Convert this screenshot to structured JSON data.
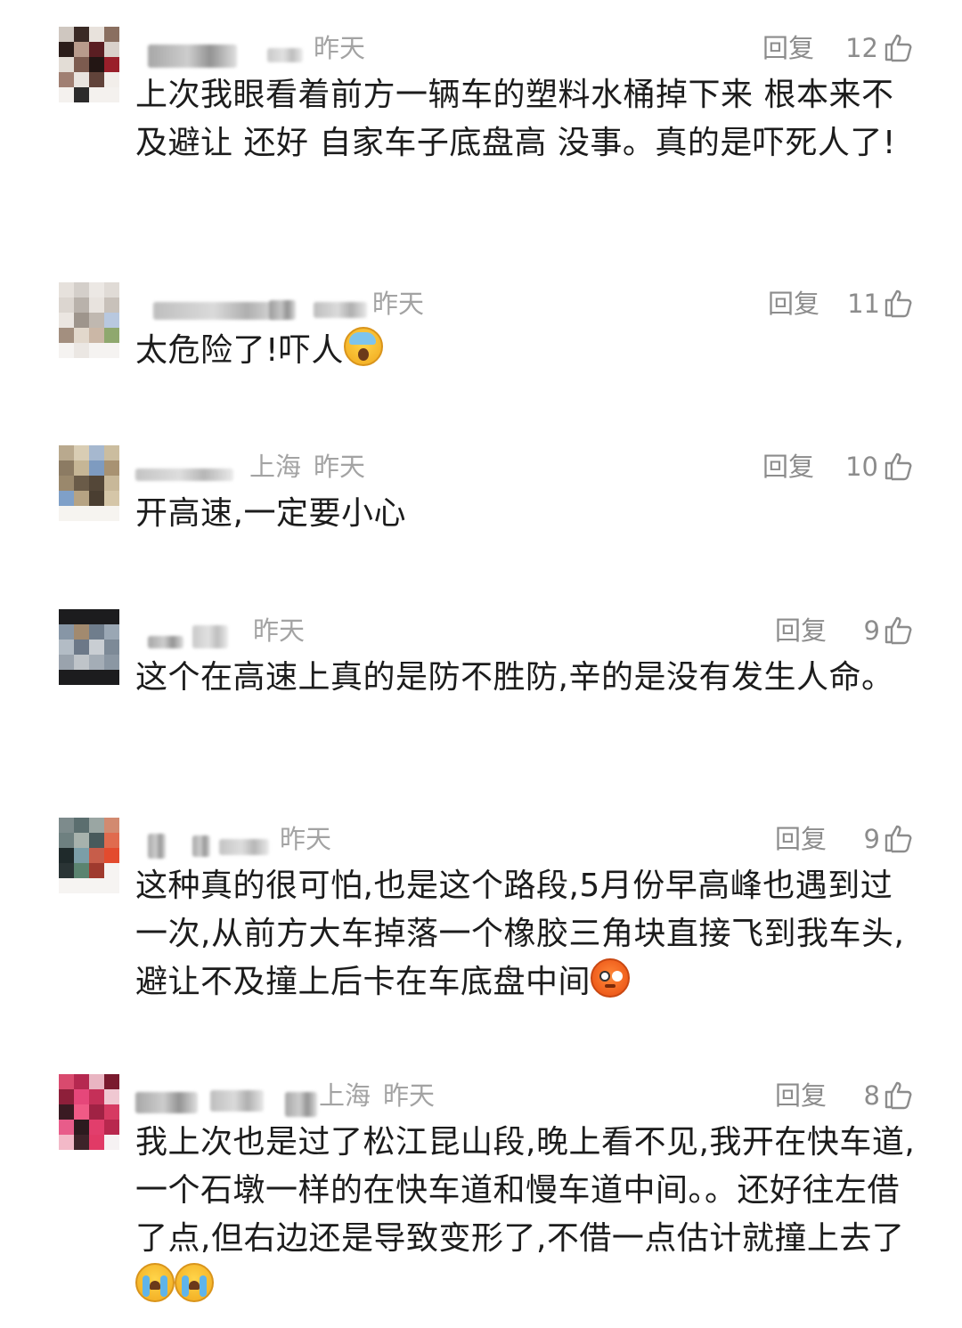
{
  "reply_label": "回复",
  "comments": [
    {
      "location": "",
      "time": "昨天",
      "likes": "12",
      "text": "上次我眼看着前方一辆车的塑料水桶掉下来 根本来不及避让 还好 自家车子底盘高 没事。真的是吓死人了!",
      "emoji": []
    },
    {
      "location": "",
      "time": "昨天",
      "likes": "11",
      "text": "太危险了!吓人",
      "emoji": [
        "face-screaming-in-fear"
      ]
    },
    {
      "location": "上海",
      "time": "昨天",
      "likes": "10",
      "text": "开高速,一定要小心",
      "emoji": []
    },
    {
      "location": "",
      "time": "昨天",
      "likes": "9",
      "text": "这个在高速上真的是防不胜防,辛的是没有发生人命。",
      "emoji": []
    },
    {
      "location": "",
      "time": "昨天",
      "likes": "9",
      "text": "这种真的很可怕,也是这个路段,5月份早高峰也遇到过一次,从前方大车掉落一个橡胶三角块直接飞到我车头,避让不及撞上后卡在车底盘中间",
      "emoji": [
        "flushed-face"
      ]
    },
    {
      "location": "上海",
      "time": "昨天",
      "likes": "8",
      "text": "我上次也是过了松江昆山段,晚上看不见,我开在快车道,一个石墩一样的在快车道和慢车道中间。。还好往左借了点,但右边还是导致变形了,不借一点估计就撞上去了",
      "emoji": [
        "loudly-crying-face",
        "loudly-crying-face"
      ]
    }
  ],
  "colors": {
    "meta_gray": "#a3a3a3",
    "action_gray": "#8c8c8c",
    "body_text": "#1c1c1c"
  }
}
